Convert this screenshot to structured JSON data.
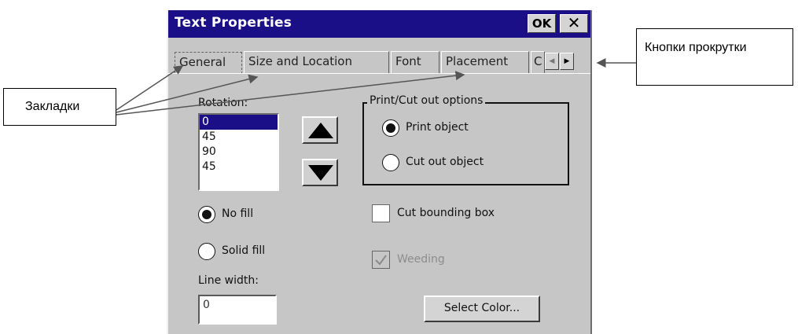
{
  "dialog": {
    "title": "Text Properties",
    "ok_label": "OK",
    "close_label": "✕"
  },
  "tabs": [
    {
      "label": "General",
      "active": true
    },
    {
      "label": "Size and Location",
      "active": false
    },
    {
      "label": "Font",
      "active": false
    },
    {
      "label": "Placement",
      "active": false
    },
    {
      "label": "C",
      "active": false
    }
  ],
  "scroll_buttons": {
    "left": "◀",
    "right": "▶"
  },
  "rotation": {
    "label": "Rotation:",
    "options": [
      "0",
      "45",
      "90",
      "45"
    ],
    "selected": "0"
  },
  "fill": {
    "no_fill_label": "No fill",
    "solid_fill_label": "Solid fill",
    "selected": "No fill"
  },
  "line_width": {
    "label": "Line width:",
    "value": "0"
  },
  "print_cut": {
    "title": "Print/Cut out options",
    "print_label": "Print object",
    "cut_label": "Cut out object",
    "selected": "Print object"
  },
  "cut_bounding_box": {
    "label": "Cut bounding box",
    "checked": false
  },
  "weeding": {
    "label": "Weeding",
    "checked": true,
    "disabled": true
  },
  "select_color_label": "Select Color...",
  "annotations": {
    "tabs_label": "Закладки",
    "scroll_label": "Кнопки прокрутки"
  }
}
